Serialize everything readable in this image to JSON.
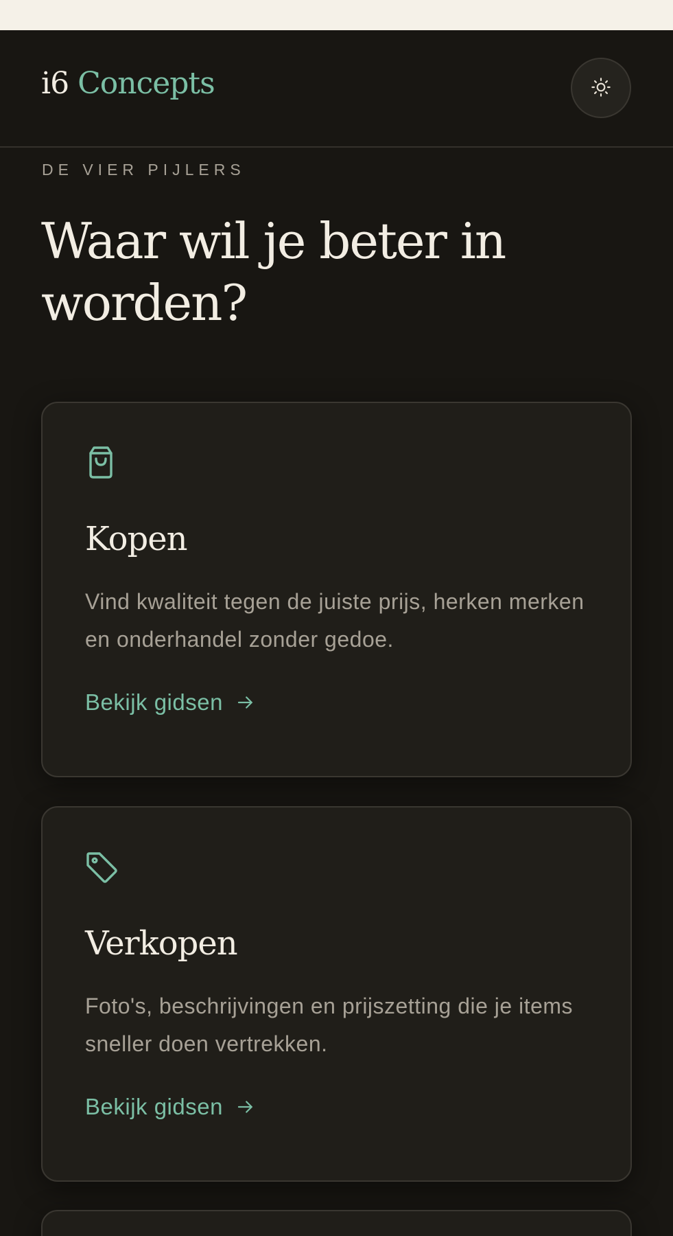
{
  "brand": {
    "number": "i6",
    "name": "Concepts"
  },
  "header": {
    "theme_toggle_icon": "sun-icon"
  },
  "section": {
    "eyebrow": "DE VIER PIJLERS",
    "heading": "Waar wil je beter in worden?"
  },
  "cards": [
    {
      "icon": "shopping-bag-icon",
      "title": "Kopen",
      "description": "Vind kwaliteit tegen de juiste prijs, herken merken en onderhandel zonder gedoe.",
      "link": "Bekijk gidsen"
    },
    {
      "icon": "tag-icon",
      "title": "Verkopen",
      "description": "Foto's, beschrijvingen en prijszetting die je items sneller doen vertrekken.",
      "link": "Bekijk gidsen"
    }
  ],
  "colors": {
    "background": "#181612",
    "top_strip": "#f5f1e8",
    "card": "#201e19",
    "accent": "#7bbfa5",
    "text_primary": "#f2ede3",
    "text_muted": "#a7a196"
  }
}
